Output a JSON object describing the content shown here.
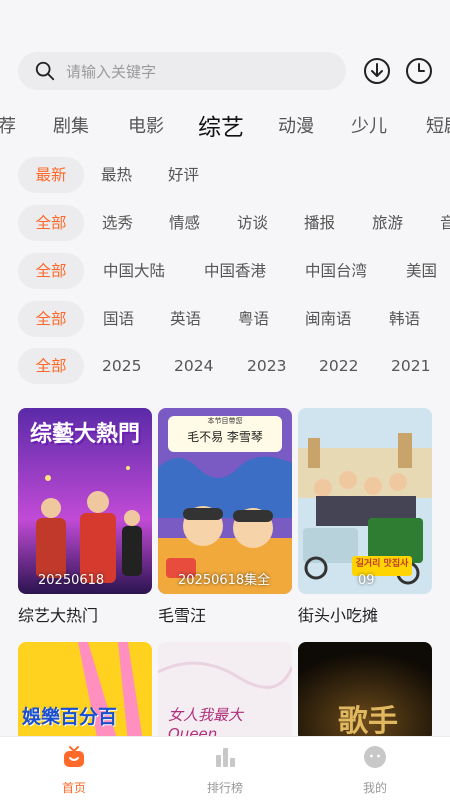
{
  "search": {
    "placeholder": "请输入关键字"
  },
  "header_icons": [
    "download-icon",
    "history-clock-icon"
  ],
  "tabs": [
    {
      "label": "荐"
    },
    {
      "label": "剧集"
    },
    {
      "label": "电影"
    },
    {
      "label": "综艺",
      "active": true
    },
    {
      "label": "动漫"
    },
    {
      "label": "少儿"
    },
    {
      "label": "短剧"
    }
  ],
  "filters": {
    "sort": [
      "最新",
      "最热",
      "好评"
    ],
    "genre": [
      "全部",
      "选秀",
      "情感",
      "访谈",
      "播报",
      "旅游",
      "音乐"
    ],
    "region": [
      "全部",
      "中国大陆",
      "中国香港",
      "中国台湾",
      "美国"
    ],
    "language": [
      "全部",
      "国语",
      "英语",
      "粤语",
      "闽南语",
      "韩语"
    ],
    "year": [
      "全部",
      "2025",
      "2024",
      "2023",
      "2022",
      "2021"
    ]
  },
  "cards": [
    {
      "title": "综艺大热门",
      "badge": "20250618",
      "poster_text": "综藝大熱門"
    },
    {
      "title": "毛雪汪",
      "badge": "20250618集全",
      "poster_text": "毛不易 李雪琴",
      "poster_subtext": "本节目带您"
    },
    {
      "title": "街头小吃摊",
      "badge": "09",
      "poster_text": "길거리 맛집사"
    },
    {
      "title": "",
      "badge": "",
      "poster_text": "娛樂百分百"
    },
    {
      "title": "",
      "badge": "",
      "poster_text": "女人我最大 Queen"
    },
    {
      "title": "",
      "badge": "",
      "poster_text": "歌手"
    }
  ],
  "bottom_nav": [
    {
      "label": "首页",
      "icon": "home-icon",
      "active": true
    },
    {
      "label": "排行榜",
      "icon": "ranking-icon"
    },
    {
      "label": "我的",
      "icon": "profile-icon"
    }
  ],
  "colors": {
    "accent": "#ff6a2a",
    "chip_bg": "#ececee",
    "background": "#f6f6f8"
  }
}
